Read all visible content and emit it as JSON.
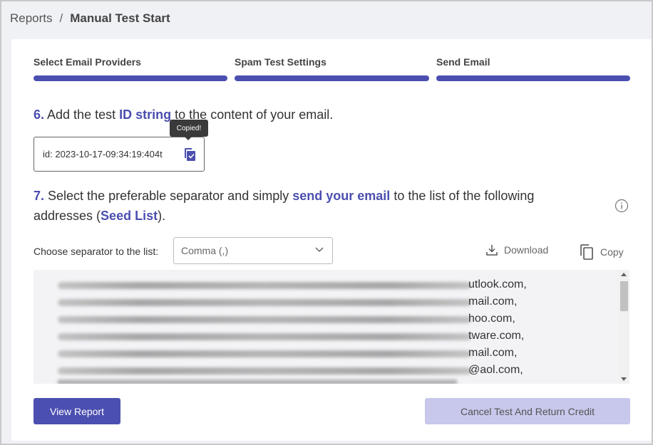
{
  "breadcrumb": {
    "parent": "Reports",
    "separator": "/",
    "current": "Manual Test Start"
  },
  "steps": [
    {
      "label": "Select Email Providers",
      "complete": true
    },
    {
      "label": "Spam Test Settings",
      "complete": true
    },
    {
      "label": "Send Email",
      "complete": true
    }
  ],
  "step6": {
    "number": "6.",
    "text_before": "Add the test",
    "link": "ID string",
    "text_after": "to the content of your email.",
    "id_value": "id: 2023-10-17-09:34:19:404t",
    "tooltip": "Copied!",
    "icon": "copy-checked-icon"
  },
  "step7": {
    "number": "7.",
    "text_before": "Select the preferable separator and simply",
    "link1": "send your email",
    "text_middle": "to the list of the following addresses (",
    "link2": "Seed List",
    "text_after": ").",
    "info_icon": "info-icon"
  },
  "separator": {
    "label": "Choose separator to the list:",
    "selected": "Comma (,)"
  },
  "actions": {
    "download": "Download",
    "copy": "Copy"
  },
  "seed_list": [
    "utlook.com,",
    "mail.com,",
    "hoo.com,",
    "tware.com,",
    "mail.com,",
    "@aol.com,"
  ],
  "buttons": {
    "view_report": "View Report",
    "cancel": "Cancel Test And Return Credit"
  },
  "colors": {
    "accent": "#4b4fb0",
    "disabled_button": "#c7c8eb"
  }
}
